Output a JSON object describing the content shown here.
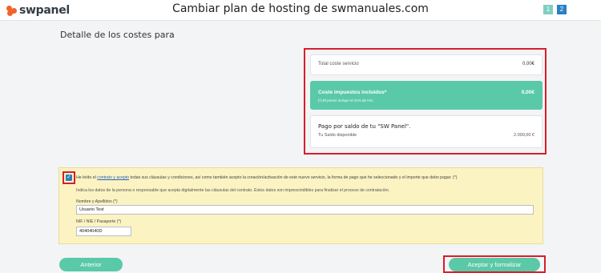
{
  "header": {
    "logo_text": "swpanel",
    "title": "Cambiar plan de hosting de swmanuales.com",
    "pages": [
      {
        "label": "1",
        "color": "#7fcfc0"
      },
      {
        "label": "2",
        "color": "#2a7fc6"
      }
    ]
  },
  "section": {
    "heading": "Detalle de los costes para"
  },
  "costs": {
    "total_label": "Total coste servicio",
    "total_value": "0,00€",
    "tax_label": "Coste impuestos incluidos*",
    "tax_note": "(*) El precio incluye el 21% de IVA.",
    "tax_value": "0,00€",
    "payment_label": "Pago por saldo de tu \"SW Panel\".",
    "balance_label": "Tu Saldo disponible",
    "balance_value": "2.000,00 €"
  },
  "contract": {
    "checked": true,
    "text_before": "He leído el ",
    "link_text": "contrato y acepto",
    "text_after": " todas sus cláusulas y condiciones, así como también acepto la creación/activación de este nuevo servicio, la forma de pago que he seleccionado y el importe que debo pagar.  (*)",
    "info": "Indica los datos de la persona o responsable que acepta digitalmente las cláusulas del contrato. Estos datos son imprescindibles para finalizar el proceso de contratación.",
    "name_label": "Nombre y Apellidos (*)",
    "name_value": "Usuario Test",
    "nif_label": "NIF / NIE / Pasaporte (*)",
    "nif_value": "40404040D"
  },
  "actions": {
    "back_label": "Anterior",
    "accept_label": "Aceptar y formalizar"
  },
  "colors": {
    "accent": "#5ac9a8",
    "highlight": "#d81e2a",
    "contract_bg": "#fcf3c2",
    "brand_orange": "#f0642a"
  }
}
